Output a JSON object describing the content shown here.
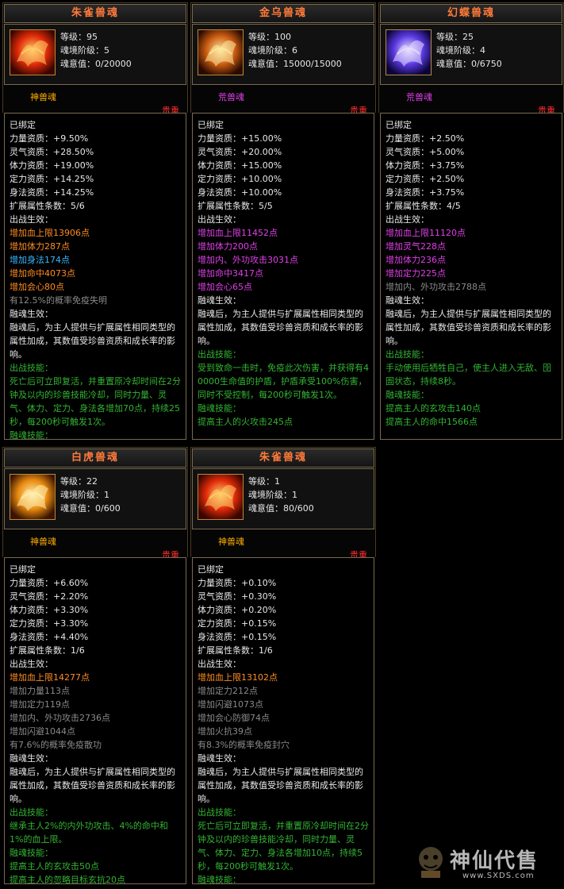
{
  "labels": {
    "level": "等级：",
    "soul_stage": "魂境阶级：",
    "soul_will": "魂意值："
  },
  "cards": [
    {
      "title": "朱雀兽魂",
      "level": "95",
      "stage": "5",
      "will": "0/20000",
      "type": "神兽魂",
      "type_color": "#ffae00",
      "rarity": "贵重",
      "icon": "vermilion-bird-icon",
      "lines": [
        {
          "t": "已绑定",
          "c": "white"
        },
        {
          "t": "力量资质：+9.50%",
          "c": "white"
        },
        {
          "t": "灵气资质：+28.50%",
          "c": "white"
        },
        {
          "t": "体力资质：+19.00%",
          "c": "white"
        },
        {
          "t": "定力资质：+14.25%",
          "c": "white"
        },
        {
          "t": "身法资质：+14.25%",
          "c": "white"
        },
        {
          "t": "扩展属性条数：5/6",
          "c": "white"
        },
        {
          "t": "出战生效：",
          "c": "white"
        },
        {
          "t": "增加血上限13906点",
          "c": "orange"
        },
        {
          "t": "增加体力287点",
          "c": "orange"
        },
        {
          "t": "增加身法174点",
          "c": "blue"
        },
        {
          "t": "增加命中4073点",
          "c": "orange"
        },
        {
          "t": "增加会心80点",
          "c": "orange"
        },
        {
          "t": "有12.5%的概率免疫失明",
          "c": "gray"
        },
        {
          "t": "融魂生效：",
          "c": "white"
        },
        {
          "t": "融魂后，为主人提供与扩展属性相同类型的属性加成，其数值受珍兽资质和成长率的影响。",
          "c": "white",
          "wrap": true
        },
        {
          "t": "出战技能：",
          "c": "green"
        },
        {
          "t": "死亡后可立即复活，并重置原冷却时间在2分钟及以内的珍兽技能冷却，同时力量、灵气、体力、定力、身法各增加70点，持续25秒，每200秒可触发1次。",
          "c": "green",
          "wrap": true
        },
        {
          "t": "融魂技能：",
          "c": "green"
        }
      ]
    },
    {
      "title": "金乌兽魂",
      "level": "100",
      "stage": "6",
      "will": "15000/15000",
      "type": "荒兽魂",
      "type_color": "#e040e8",
      "rarity": "贵重",
      "icon": "golden-crow-icon",
      "lines": [
        {
          "t": "已绑定",
          "c": "white"
        },
        {
          "t": "力量资质：+15.00%",
          "c": "white"
        },
        {
          "t": "灵气资质：+20.00%",
          "c": "white"
        },
        {
          "t": "体力资质：+15.00%",
          "c": "white"
        },
        {
          "t": "定力资质：+10.00%",
          "c": "white"
        },
        {
          "t": "身法资质：+10.00%",
          "c": "white"
        },
        {
          "t": "扩展属性条数：5/5",
          "c": "white"
        },
        {
          "t": "出战生效：",
          "c": "white"
        },
        {
          "t": "增加血上限11452点",
          "c": "purple"
        },
        {
          "t": "增加体力200点",
          "c": "purple"
        },
        {
          "t": "增加内、外功攻击3031点",
          "c": "purple"
        },
        {
          "t": "增加命中3417点",
          "c": "purple"
        },
        {
          "t": "增加会心65点",
          "c": "purple"
        },
        {
          "t": "融魂生效：",
          "c": "white"
        },
        {
          "t": "融魂后，为主人提供与扩展属性相同类型的属性加成，其数值受珍兽资质和成长率的影响。",
          "c": "white",
          "wrap": true
        },
        {
          "t": "出战技能：",
          "c": "green"
        },
        {
          "t": "受到致命一击时，免疫此次伤害，并获得有40000生命值的护盾，护盾承受100%伤害，同时不受控制，每200秒可触发1次。",
          "c": "green",
          "wrap": true
        },
        {
          "t": "融魂技能：",
          "c": "green"
        },
        {
          "t": "提高主人的火攻击245点",
          "c": "green"
        }
      ]
    },
    {
      "title": "幻蝶兽魂",
      "level": "25",
      "stage": "4",
      "will": "0/6750",
      "type": "荒兽魂",
      "type_color": "#e040e8",
      "rarity": "贵重",
      "icon": "illusion-butterfly-icon",
      "lines": [
        {
          "t": "已绑定",
          "c": "white"
        },
        {
          "t": "力量资质：+2.50%",
          "c": "white"
        },
        {
          "t": "灵气资质：+5.00%",
          "c": "white"
        },
        {
          "t": "体力资质：+3.75%",
          "c": "white"
        },
        {
          "t": "定力资质：+2.50%",
          "c": "white"
        },
        {
          "t": "身法资质：+3.75%",
          "c": "white"
        },
        {
          "t": "扩展属性条数：4/5",
          "c": "white"
        },
        {
          "t": "出战生效：",
          "c": "white"
        },
        {
          "t": "增加血上限11120点",
          "c": "purple"
        },
        {
          "t": "增加灵气228点",
          "c": "purple"
        },
        {
          "t": "增加体力236点",
          "c": "purple"
        },
        {
          "t": "增加定力225点",
          "c": "purple"
        },
        {
          "t": "增加内、外功攻击2788点",
          "c": "gray"
        },
        {
          "t": "融魂生效：",
          "c": "white"
        },
        {
          "t": "融魂后，为主人提供与扩展属性相同类型的属性加成，其数值受珍兽资质和成长率的影响。",
          "c": "white",
          "wrap": true
        },
        {
          "t": "出战技能：",
          "c": "green"
        },
        {
          "t": "手动使用后牺牲自己，使主人进入无敌、囹圄状态，持续8秒。",
          "c": "green",
          "wrap": true
        },
        {
          "t": "融魂技能：",
          "c": "green"
        },
        {
          "t": "提高主人的玄攻击140点",
          "c": "green"
        },
        {
          "t": "提高主人的命中1566点",
          "c": "green"
        }
      ]
    },
    {
      "title": "白虎兽魂",
      "level": "22",
      "stage": "1",
      "will": "0/600",
      "type": "神兽魂",
      "type_color": "#ffae00",
      "rarity": "贵重",
      "icon": "white-tiger-icon",
      "lines": [
        {
          "t": "已绑定",
          "c": "white"
        },
        {
          "t": "力量资质：+6.60%",
          "c": "white"
        },
        {
          "t": "灵气资质：+2.20%",
          "c": "white"
        },
        {
          "t": "体力资质：+3.30%",
          "c": "white"
        },
        {
          "t": "定力资质：+3.30%",
          "c": "white"
        },
        {
          "t": "身法资质：+4.40%",
          "c": "white"
        },
        {
          "t": "扩展属性条数：1/6",
          "c": "white"
        },
        {
          "t": "出战生效：",
          "c": "white"
        },
        {
          "t": "增加血上限14277点",
          "c": "orange"
        },
        {
          "t": "增加力量113点",
          "c": "gray"
        },
        {
          "t": "增加定力119点",
          "c": "gray"
        },
        {
          "t": "增加内、外功攻击2736点",
          "c": "gray"
        },
        {
          "t": "增加闪避1044点",
          "c": "gray"
        },
        {
          "t": "有7.6%的概率免疫散功",
          "c": "gray"
        },
        {
          "t": "融魂生效：",
          "c": "white"
        },
        {
          "t": "融魂后，为主人提供与扩展属性相同类型的属性加成，其数值受珍兽资质和成长率的影响。",
          "c": "white",
          "wrap": true
        },
        {
          "t": "出战技能：",
          "c": "green"
        },
        {
          "t": "继承主人2%的内外功攻击、4%的命中和1%的血上限。",
          "c": "green",
          "wrap": true
        },
        {
          "t": "融魂技能：",
          "c": "green"
        },
        {
          "t": "提高主人的玄攻击50点",
          "c": "green"
        },
        {
          "t": "提高主人的忽略目标玄抗20点",
          "c": "green"
        }
      ]
    },
    {
      "title": "朱雀兽魂",
      "level": "1",
      "stage": "1",
      "will": "80/600",
      "type": "神兽魂",
      "type_color": "#ffae00",
      "rarity": "贵重",
      "icon": "vermilion-bird-icon",
      "lines": [
        {
          "t": "已绑定",
          "c": "white"
        },
        {
          "t": "力量资质：+0.10%",
          "c": "white"
        },
        {
          "t": "灵气资质：+0.30%",
          "c": "white"
        },
        {
          "t": "体力资质：+0.20%",
          "c": "white"
        },
        {
          "t": "定力资质：+0.15%",
          "c": "white"
        },
        {
          "t": "身法资质：+0.15%",
          "c": "white"
        },
        {
          "t": "扩展属性条数：1/6",
          "c": "white"
        },
        {
          "t": "出战生效：",
          "c": "white"
        },
        {
          "t": "增加血上限13102点",
          "c": "orange"
        },
        {
          "t": "增加定力212点",
          "c": "gray"
        },
        {
          "t": "增加闪避1073点",
          "c": "gray"
        },
        {
          "t": "增加会心防御74点",
          "c": "gray"
        },
        {
          "t": "增加火抗39点",
          "c": "gray"
        },
        {
          "t": "有8.3%的概率免疫封穴",
          "c": "gray"
        },
        {
          "t": "融魂生效：",
          "c": "white"
        },
        {
          "t": "融魂后，为主人提供与扩展属性相同类型的属性加成，其数值受珍兽资质和成长率的影响。",
          "c": "white",
          "wrap": true
        },
        {
          "t": "出战技能：",
          "c": "green"
        },
        {
          "t": "死亡后可立即复活，并重置原冷却时间在2分钟及以内的珍兽技能冷却，同时力量、灵气、体力、定力、身法各增加10点，持续5秒，每200秒可触发1次。",
          "c": "green",
          "wrap": true
        },
        {
          "t": "融魂技能：",
          "c": "green"
        }
      ]
    }
  ],
  "watermark": {
    "text": "神仙代售",
    "url": "www.SXDS.com"
  }
}
